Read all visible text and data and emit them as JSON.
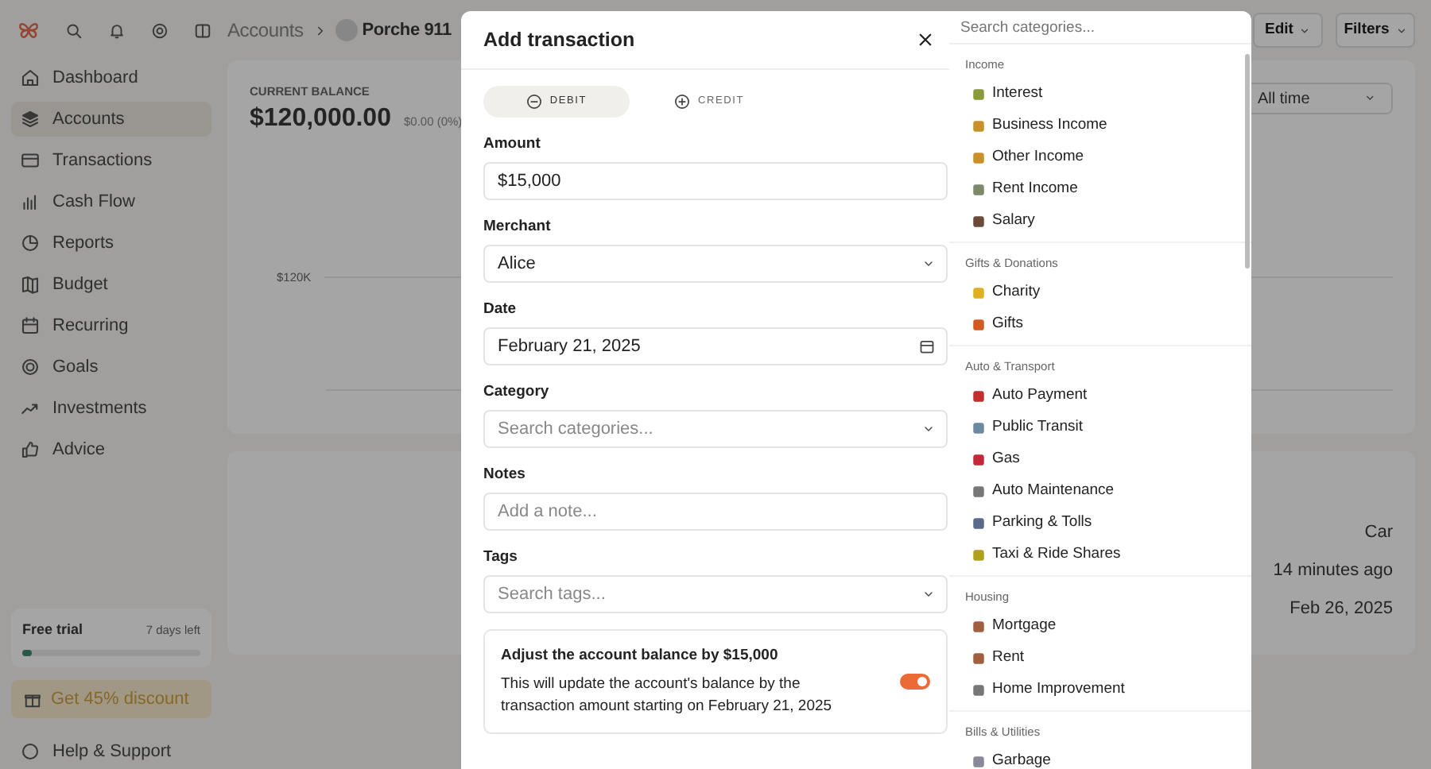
{
  "sidebar": {
    "nav": [
      {
        "label": "Dashboard",
        "selected": false
      },
      {
        "label": "Accounts",
        "selected": true
      },
      {
        "label": "Transactions",
        "selected": false
      },
      {
        "label": "Cash Flow",
        "selected": false
      },
      {
        "label": "Reports",
        "selected": false
      },
      {
        "label": "Budget",
        "selected": false
      },
      {
        "label": "Recurring",
        "selected": false
      },
      {
        "label": "Goals",
        "selected": false
      },
      {
        "label": "Investments",
        "selected": false
      },
      {
        "label": "Advice",
        "selected": false
      }
    ],
    "trial": {
      "title": "Free trial",
      "remaining": "7 days left",
      "level": 0.05
    },
    "discount_button": "Get 45% discount",
    "help_link": "Help & Support"
  },
  "header": {
    "breadcrumb": [
      "Accounts",
      "Porche 911"
    ],
    "buttons": [
      "Edit",
      "Filters"
    ]
  },
  "balance_card": {
    "label": "CURRENT BALANCE",
    "amount": "$120,000.00",
    "change": "$0.00 (0%)",
    "range": "All time",
    "axis_label": "$120K"
  },
  "details_card": {
    "values": [
      "Car",
      "14 minutes ago",
      "Feb 26, 2025"
    ]
  },
  "modal": {
    "title": "Add transaction",
    "types": [
      {
        "label": "DEBIT",
        "selected": true
      },
      {
        "label": "CREDIT",
        "selected": false
      }
    ],
    "fields": [
      {
        "label": "Amount",
        "kind": "text",
        "value": "$15,000"
      },
      {
        "label": "Merchant",
        "kind": "select",
        "value": "Alice"
      },
      {
        "label": "Date",
        "kind": "date",
        "value": "February 21, 2025"
      },
      {
        "label": "Category",
        "kind": "select",
        "placeholder": "Search categories..."
      },
      {
        "label": "Notes",
        "kind": "text",
        "placeholder": "Add a note..."
      },
      {
        "label": "Tags",
        "kind": "select",
        "placeholder": "Search tags..."
      }
    ],
    "adjust": {
      "title": "Adjust the account balance by $15,000",
      "description": "This will update the account's balance by the transaction amount starting on February 21, 2025",
      "on": true
    }
  },
  "category_menu": {
    "placeholder": "Search categories...",
    "groups": [
      {
        "name": "Income",
        "items": [
          "Interest",
          "Business Income",
          "Other Income",
          "Rent Income",
          "Salary"
        ]
      },
      {
        "name": "Gifts & Donations",
        "items": [
          "Charity",
          "Gifts"
        ]
      },
      {
        "name": "Auto & Transport",
        "items": [
          "Auto Payment",
          "Public Transit",
          "Gas",
          "Auto Maintenance",
          "Parking & Tolls",
          "Taxi & Ride Shares"
        ]
      },
      {
        "name": "Housing",
        "items": [
          "Mortgage",
          "Rent",
          "Home Improvement"
        ]
      },
      {
        "name": "Bills & Utilities",
        "items": [
          "Garbage"
        ]
      }
    ]
  }
}
